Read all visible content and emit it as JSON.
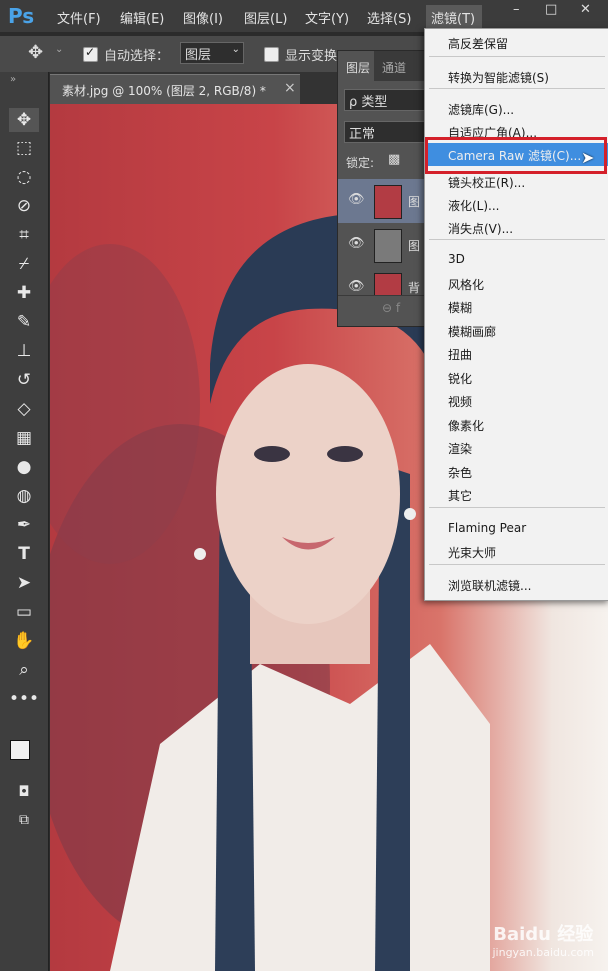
{
  "app": {
    "logo": "Ps"
  },
  "menubar": {
    "items": [
      "文件(F)",
      "编辑(E)",
      "图像(I)",
      "图层(L)",
      "文字(Y)",
      "选择(S)",
      "滤镜(T)"
    ],
    "window_controls": [
      "–",
      "□",
      "✕"
    ]
  },
  "options": {
    "move_glyph": "✥",
    "auto_select_label": "自动选择：",
    "auto_select_checked": true,
    "auto_select_value": "图层",
    "show_transform_label": "显示变换"
  },
  "document": {
    "tab_title": "素材.jpg @ 100% (图层 2, RGB/8) *",
    "close": "×",
    "tabbar_glyph": "»"
  },
  "layers_panel": {
    "tab_layers": "图层",
    "tab_channels": "通道",
    "kind_label": "ρ 类型",
    "blend_mode": "正常",
    "lock_label": "锁定:",
    "rows": [
      {
        "name": "图"
      },
      {
        "name": "图"
      },
      {
        "name": "背"
      }
    ],
    "footer": "⊖  f"
  },
  "filter_menu": {
    "items": [
      {
        "label": "高反差保留",
        "group": 1
      },
      {
        "label": "转换为智能滤镜(S)",
        "group": 2
      },
      {
        "label": "滤镜库(G)...",
        "group": 3
      },
      {
        "label": "自适应广角(A)...",
        "group": 3
      },
      {
        "label": "Camera Raw 滤镜(C)...",
        "group": 3,
        "highlighted": true
      },
      {
        "label": "镜头校正(R)...",
        "group": 3
      },
      {
        "label": "液化(L)...",
        "group": 3
      },
      {
        "label": "消失点(V)...",
        "group": 3
      },
      {
        "label": "3D",
        "group": 4
      },
      {
        "label": "风格化",
        "group": 4
      },
      {
        "label": "模糊",
        "group": 4
      },
      {
        "label": "模糊画廊",
        "group": 4
      },
      {
        "label": "扭曲",
        "group": 4
      },
      {
        "label": "锐化",
        "group": 4
      },
      {
        "label": "视频",
        "group": 4
      },
      {
        "label": "像素化",
        "group": 4
      },
      {
        "label": "渲染",
        "group": 4
      },
      {
        "label": "杂色",
        "group": 4
      },
      {
        "label": "其它",
        "group": 4
      },
      {
        "label": "Flaming Pear",
        "group": 5
      },
      {
        "label": "光束大师",
        "group": 5
      },
      {
        "label": "浏览联机滤镜...",
        "group": 6
      }
    ]
  },
  "watermark": {
    "line1": "Baidu 经验",
    "line2": "jingyan.baidu.com"
  },
  "colors": {
    "highlight": "#3f8ee0",
    "callout": "#d4202a",
    "accent": "#4aa3e8"
  }
}
